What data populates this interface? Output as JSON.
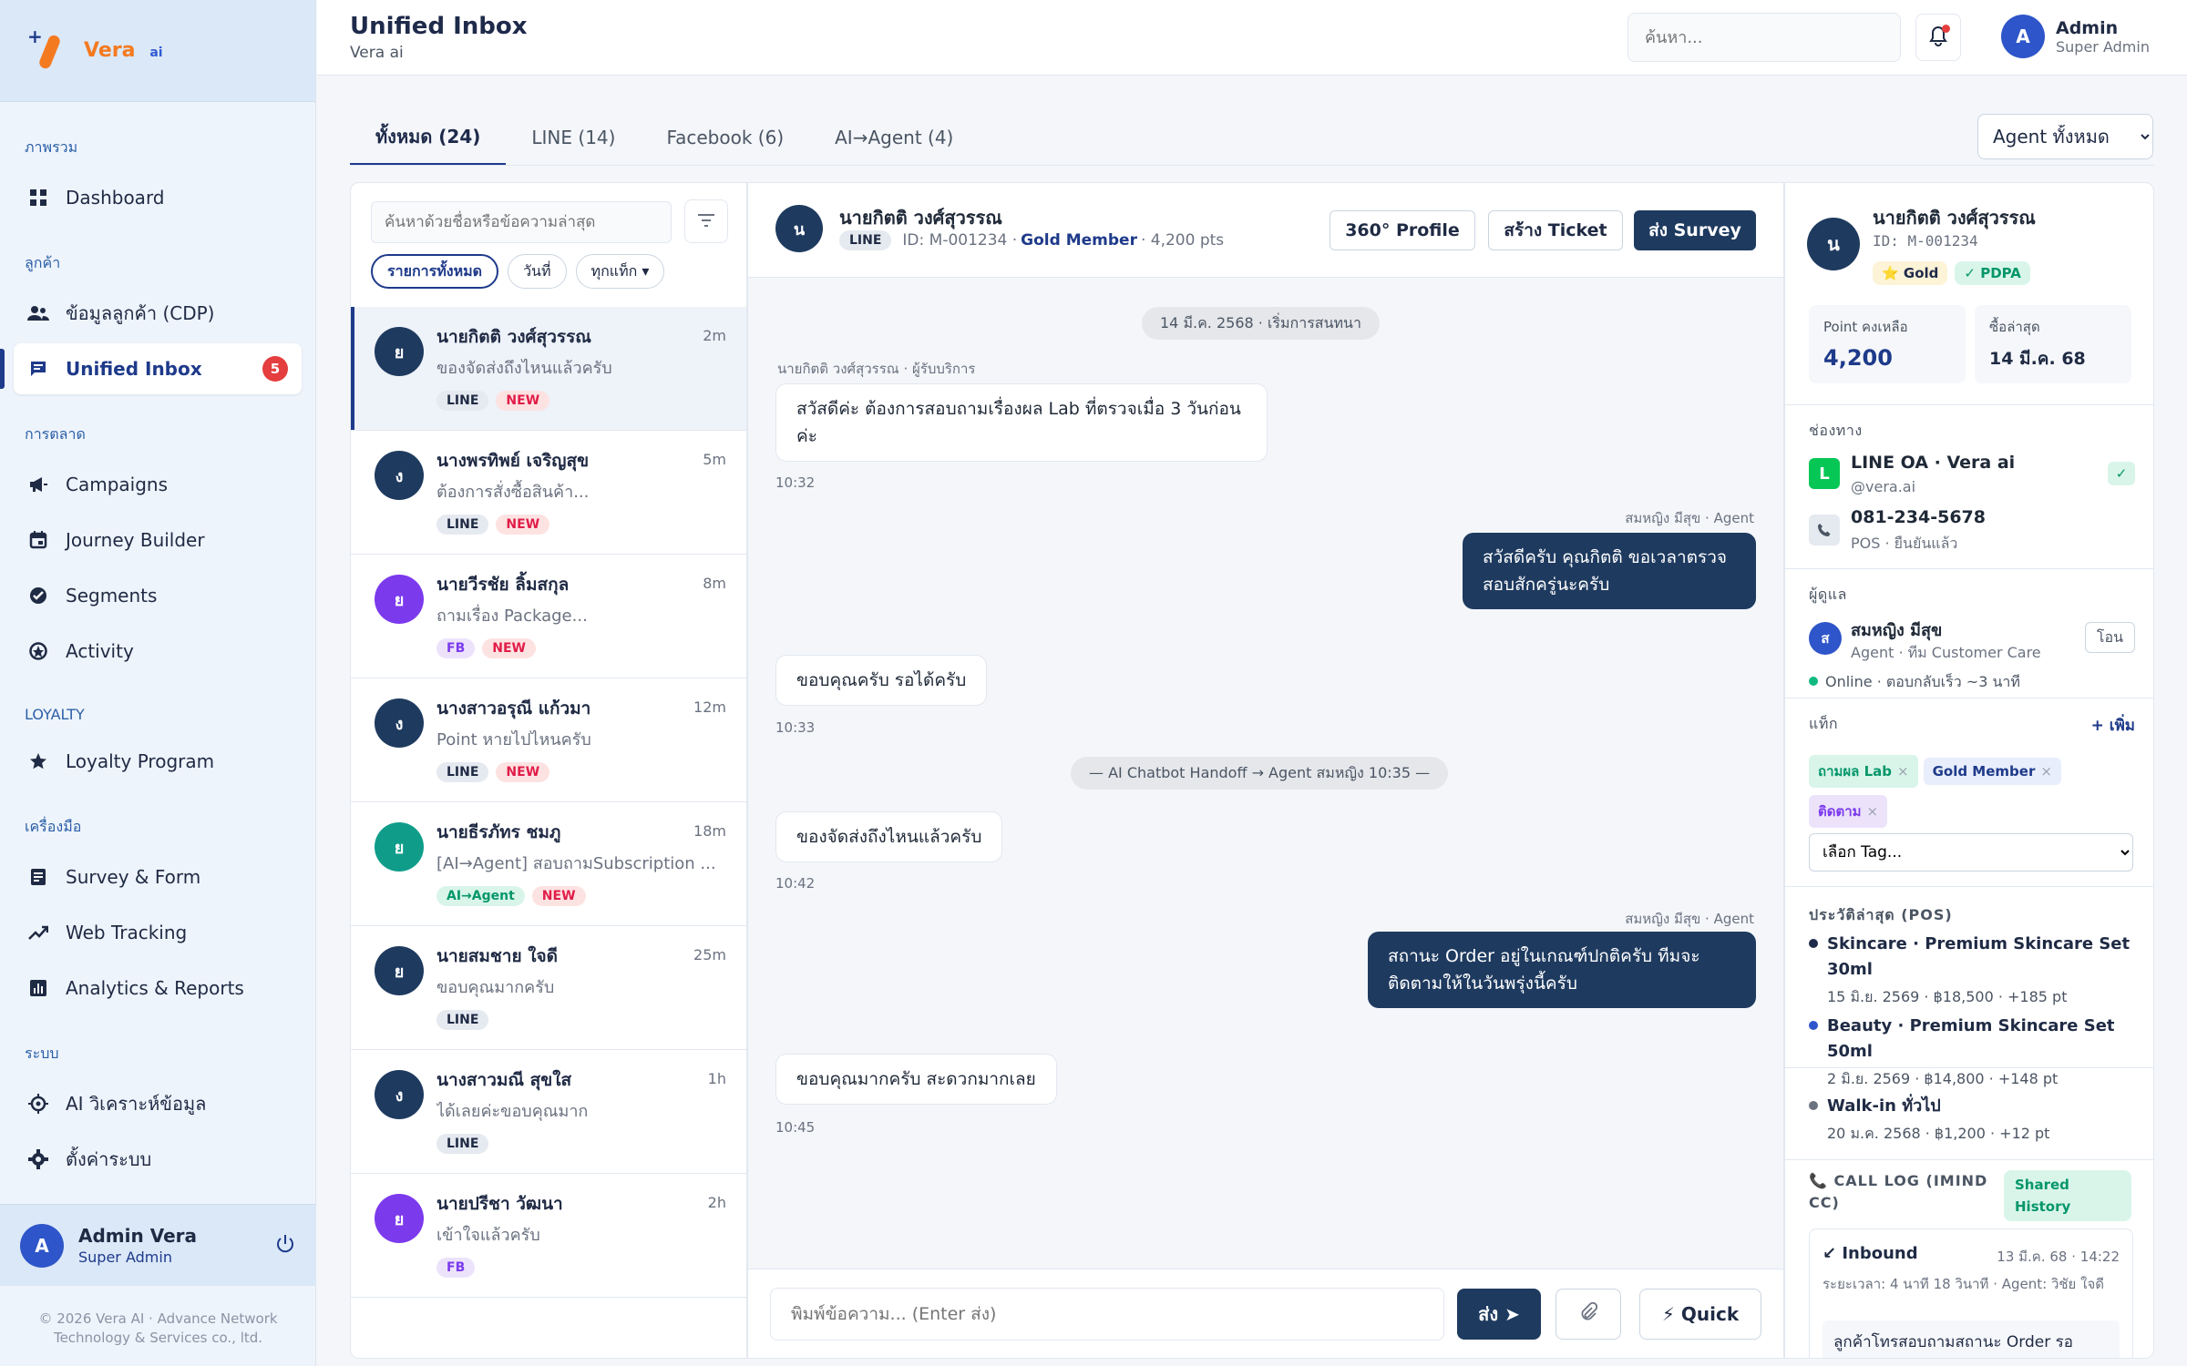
{
  "brand": {
    "name_a": "Vera",
    "name_b": " ai"
  },
  "sidebar": {
    "sections": [
      {
        "label": "ภาพรวม"
      },
      {
        "label": "ลูกค้า"
      },
      {
        "label": "การตลาด"
      },
      {
        "label": "LOYALTY"
      },
      {
        "label": "เครื่องมือ"
      },
      {
        "label": "ระบบ"
      }
    ],
    "items": [
      {
        "label": "Dashboard",
        "icon": "grid-icon"
      },
      {
        "label": "ข้อมูลลูกค้า (CDP)",
        "icon": "users-icon"
      },
      {
        "label": "Unified Inbox",
        "icon": "chat-icon",
        "badge": "5"
      },
      {
        "label": "Campaigns",
        "icon": "megaphone-icon"
      },
      {
        "label": "Journey Builder",
        "icon": "calendar-icon"
      },
      {
        "label": "Segments",
        "icon": "check-circle-icon"
      },
      {
        "label": "Activity",
        "icon": "activity-icon"
      },
      {
        "label": "Loyalty Program",
        "icon": "star-icon"
      },
      {
        "label": "Survey & Form",
        "icon": "form-icon"
      },
      {
        "label": "Web Tracking",
        "icon": "trend-icon"
      },
      {
        "label": "Analytics & Reports",
        "icon": "bar-chart-icon"
      },
      {
        "label": "AI วิเคราะห์ข้อมูล",
        "icon": "ai-icon"
      },
      {
        "label": "ตั้งค่าระบบ",
        "icon": "gear-icon"
      }
    ],
    "user": {
      "initial": "A",
      "name": "Admin Vera",
      "role": "Super Admin"
    },
    "copyright_1": "© 2026 Vera AI · Advance Network",
    "copyright_2": "Technology & Services co., ltd."
  },
  "header": {
    "title": "Unified Inbox",
    "subtitle": "Vera ai",
    "search_placeholder": "ค้นหา...",
    "user": {
      "initial": "A",
      "name": "Admin",
      "role": "Super Admin"
    }
  },
  "tabs": [
    {
      "label": "ทั้งหมด (24)"
    },
    {
      "label": "LINE (14)"
    },
    {
      "label": "Facebook (6)"
    },
    {
      "label": "AI→Agent (4)"
    }
  ],
  "agent_filter": {
    "selected": "Agent ทั้งหมด"
  },
  "list": {
    "search_placeholder": "ค้นหาด้วยชื่อหรือข้อความล่าสุด",
    "chips": [
      "รายการทั้งหมด",
      "วันที่",
      "ทุกแท็ก ▾"
    ],
    "conversations": [
      {
        "initial": "ย",
        "name": "นายกิตติ วงศ์สุวรรณ",
        "time": "2m",
        "preview": "ของจัดส่งถึงไหนแล้วครับ",
        "channel": "LINE",
        "new": "NEW",
        "color": "#1e3a5f"
      },
      {
        "initial": "ง",
        "name": "นางพรทิพย์ เจริญสุข",
        "time": "5m",
        "preview": "ต้องการสั่งซื้อสินค้า...",
        "channel": "LINE",
        "new": "NEW",
        "color": "#1e3a5f"
      },
      {
        "initial": "ย",
        "name": "นายวีรชัย ลิ้มสกุล",
        "time": "8m",
        "preview": "ถามเรื่อง Package...",
        "channel": "FB",
        "new": "NEW",
        "color": "#7c3aed"
      },
      {
        "initial": "ง",
        "name": "นางสาวอรุณี แก้วมา",
        "time": "12m",
        "preview": "Point หายไปไหนครับ",
        "channel": "LINE",
        "new": "NEW",
        "color": "#1e3a5f"
      },
      {
        "initial": "ย",
        "name": "นายธีรภัทร ชมภู",
        "time": "18m",
        "preview": "[AI→Agent] สอบถามSubscription ...",
        "channel": "AI→Agent",
        "new": "NEW",
        "color": "#0f9d8a"
      },
      {
        "initial": "ย",
        "name": "นายสมชาย ใจดี",
        "time": "25m",
        "preview": "ขอบคุณมากครับ",
        "channel": "LINE",
        "new": "",
        "color": "#1e3a5f"
      },
      {
        "initial": "ง",
        "name": "นางสาวมณี สุขใส",
        "time": "1h",
        "preview": "ได้เลยค่ะขอบคุณมาก",
        "channel": "LINE",
        "new": "",
        "color": "#1e3a5f"
      },
      {
        "initial": "ย",
        "name": "นายปรีชา วัฒนา",
        "time": "2h",
        "preview": "เข้าใจแล้วครับ",
        "channel": "FB",
        "new": "",
        "color": "#7c3aed"
      }
    ]
  },
  "chat": {
    "initial": "น",
    "name": "นายกิตติ วงศ์สุวรรณ",
    "channel": "LINE",
    "id": "ID: M-001234 ·",
    "tier": "Gold Member",
    "points": "· 4,200 pts",
    "btn_profile": "360° Profile",
    "btn_ticket": "สร้าง Ticket",
    "btn_survey": "ส่ง Survey",
    "date_divider": "14 มี.ค. 2568 · เริ่มการสนทนา",
    "customer_label": "นายกิตติ วงศ์สุวรรณ · ผู้รับบริการ",
    "agent_label": "สมหญิง มีสุข · Agent",
    "handoff": "— AI Chatbot Handoff → Agent สมหญิง 10:35 —",
    "messages": [
      {
        "text": "สวัสดีค่ะ ต้องการสอบถามเรื่องผล Lab ที่ตรวจเมื่อ 3 วันก่อนค่ะ",
        "time": "10:32"
      },
      {
        "text": "สวัสดีครับ คุณกิตติ ขอเวลาตรวจสอบสักครู่นะครับ"
      },
      {
        "text": "ขอบคุณครับ รอได้ครับ",
        "time": "10:33"
      },
      {
        "text": "ของจัดส่งถึงไหนแล้วครับ",
        "time": "10:42"
      },
      {
        "text": "สถานะ Order อยู่ในเกณฑ์ปกติครับ ทีมจะติดตามให้ในวันพรุ่งนี้ครับ"
      },
      {
        "text": "ขอบคุณมากครับ สะดวกมากเลย",
        "time": "10:45"
      }
    ],
    "input_placeholder": "พิมพ์ข้อความ... (Enter ส่ง)",
    "send": "ส่ง ➤",
    "quick": "⚡ Quick"
  },
  "profile": {
    "initial": "น",
    "name": "นายกิตติ วงศ์สุวรรณ",
    "id": "ID: M-001234",
    "tier_tag": "⭐ Gold",
    "pdpa_tag": "✓ PDPA",
    "points_label": "Point คงเหลือ",
    "points_value": "4,200",
    "last_buy_label": "ซื้อล่าสุด",
    "last_buy_value": "14 มี.ค. 68",
    "channels_title": "ช่องทาง",
    "line_name": "LINE OA · Vera ai",
    "line_handle": "@vera.ai",
    "line_icon": "L",
    "phone": "081-234-5678",
    "phone_sub": "POS · ยืนยันแล้ว",
    "owner_title": "ผู้ดูแล",
    "owner_initial": "ส",
    "owner_name": "สมหญิง มีสุข",
    "owner_role": "Agent · ทีม Customer Care",
    "owner_status": "Online · ตอบกลับเร็ว ~3 นาที",
    "transfer": "โอน",
    "tags_title": "แท็ก",
    "add_tag": "+ เพิ่ม",
    "tags": [
      {
        "label": "ถามผล Lab",
        "color": "#059669",
        "bg": "#d9f5ea"
      },
      {
        "label": "Gold Member",
        "color": "#1e3a8a",
        "bg": "#e8eefb"
      },
      {
        "label": "ติดตาม",
        "color": "#7c3aed",
        "bg": "#ece3fb"
      }
    ],
    "tag_select": "เลือก Tag...",
    "pos_title": "ประวัติล่าสุด (POS)",
    "pos": [
      {
        "title": "Skincare · Premium Skincare Set 30ml",
        "sub": "15 มิ.ย. 2569 · ฿18,500 · +185 pt",
        "color": "#1e2a4a"
      },
      {
        "title": "Beauty · Premium Skincare Set 50ml",
        "sub": "2 มิ.ย. 2569 · ฿14,800 · +148 pt",
        "color": "#2e55c9"
      },
      {
        "title": "Walk-in ทั่วไป",
        "sub": "20 ม.ค. 2568 · ฿1,200 · +12 pt",
        "color": "#6b7280"
      }
    ],
    "call_title": "📞 CALL LOG (IMIND CC)",
    "call_badge": "Shared History",
    "call": {
      "direction": "↙ Inbound",
      "time": "13 มี.ค. 68 · 14:22",
      "detail": "ระยะเวลา: 4 นาที 18 วินาที · Agent: วิชัย ใจดี",
      "note": "ลูกค้าโทรสอบถามสถานะ Order รอ"
    }
  }
}
